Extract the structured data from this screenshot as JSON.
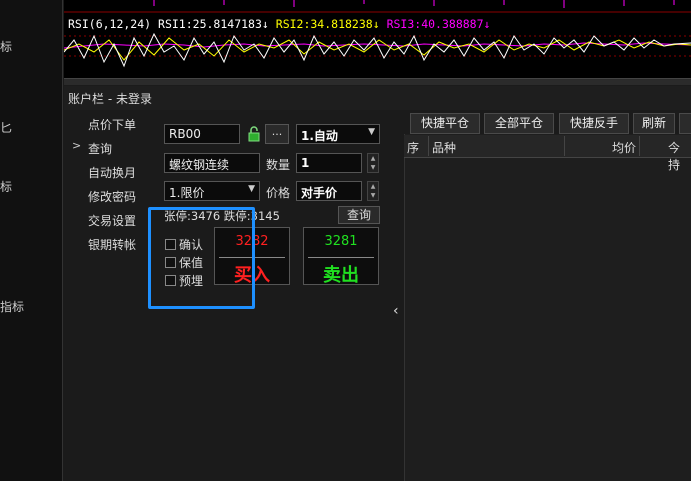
{
  "left_strip": {
    "items": [
      "标",
      "匕",
      "标",
      "指标"
    ]
  },
  "chart": {
    "indicator_label": "RSI(6,12,24)",
    "rsi1_label": "RSI1:25.8147183",
    "rsi2_label": "RSI2:34.818238",
    "rsi3_label": "RSI3:40.388887",
    "arrow": "↓",
    "colors": {
      "rsi1": "#ffffff",
      "rsi2": "#ffff00",
      "rsi3": "#ff00ff",
      "candle": "#ff00ff"
    }
  },
  "account_bar": {
    "title": "账户栏 - 未登录"
  },
  "menu": {
    "items": [
      "点价下单",
      "查询",
      "自动换月",
      "修改密码",
      "交易设置",
      "银期转帐"
    ],
    "expand_marker": ">"
  },
  "order": {
    "contract_code": "RB00",
    "lock_icon": "lock-icon",
    "more_button": "...",
    "mode_select": "1.自动",
    "contract_name": "螺纹钢连续",
    "qty_label": "数量",
    "qty_value": "1",
    "price_type_select": "1.限价",
    "price_label": "价格",
    "price_value": "对手价",
    "limit_text": "张停:3476 跌停:3145",
    "query_button": "查询",
    "checks": [
      "确认",
      "保值",
      "预埋"
    ],
    "buy_price": "3282",
    "buy_label": "买入",
    "sell_price": "3281",
    "sell_label": "卖出",
    "colors": {
      "buy": "#ff2020",
      "sell": "#20e020"
    }
  },
  "toolbar": {
    "buttons": [
      "快捷平仓",
      "全部平仓",
      "快捷反手",
      "刷新"
    ]
  },
  "grid": {
    "headers": [
      "序",
      "品种",
      "均价",
      "今持"
    ]
  }
}
